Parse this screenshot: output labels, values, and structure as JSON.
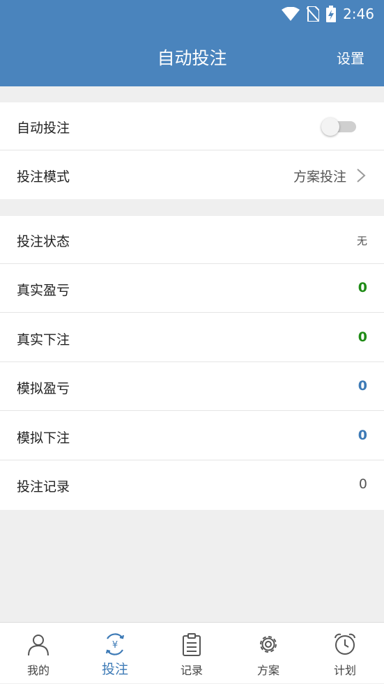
{
  "status": {
    "time": "2:46"
  },
  "appbar": {
    "title": "自动投注",
    "settings_label": "设置"
  },
  "auto_bet": {
    "label": "自动投注",
    "enabled": false
  },
  "bet_mode": {
    "label": "投注模式",
    "value": "方案投注"
  },
  "stats": [
    {
      "label": "投注状态",
      "value": "无",
      "style": "none"
    },
    {
      "label": "真实盈亏",
      "value": "0",
      "style": "green"
    },
    {
      "label": "真实下注",
      "value": "0",
      "style": "green"
    },
    {
      "label": "模拟盈亏",
      "value": "0",
      "style": "blue"
    },
    {
      "label": "模拟下注",
      "value": "0",
      "style": "blue"
    },
    {
      "label": "投注记录",
      "value": "0",
      "style": "gray"
    }
  ],
  "tabs": [
    {
      "label": "我的",
      "icon": "person-icon",
      "active": false
    },
    {
      "label": "投注",
      "icon": "bet-cycle-icon",
      "active": true
    },
    {
      "label": "记录",
      "icon": "clipboard-icon",
      "active": false
    },
    {
      "label": "方案",
      "icon": "gear-icon",
      "active": false
    },
    {
      "label": "计划",
      "icon": "alarm-clock-icon",
      "active": false
    }
  ],
  "colors": {
    "primary": "#4a84bd",
    "green": "#1f8b16",
    "blue": "#3d7ab6"
  }
}
